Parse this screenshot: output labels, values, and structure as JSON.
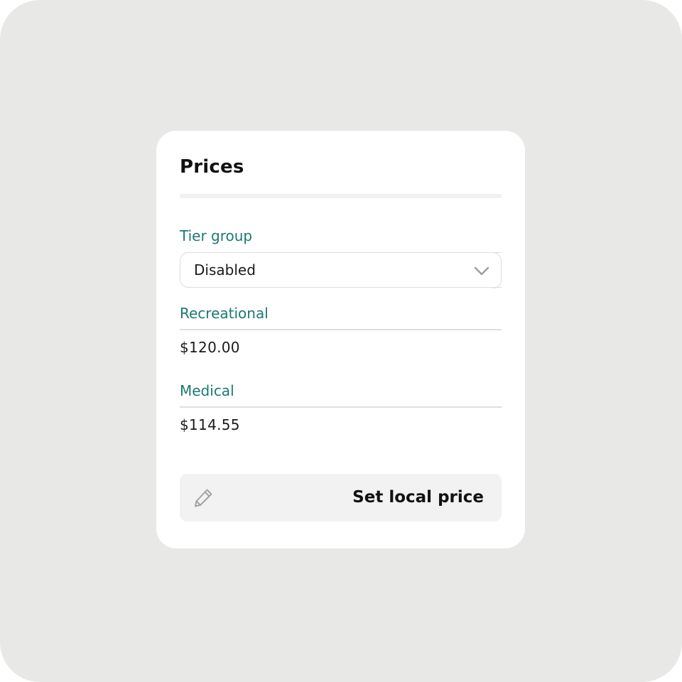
{
  "card": {
    "title": "Prices"
  },
  "tier_group": {
    "label": "Tier group",
    "selected": "Disabled"
  },
  "prices": [
    {
      "label": "Recreational",
      "value": "$120.00"
    },
    {
      "label": "Medical",
      "value": "$114.55"
    }
  ],
  "action": {
    "label": "Set local price",
    "icon": "pencil-icon"
  },
  "colors": {
    "accent": "#1c7a70",
    "background": "#e8e8e6",
    "card": "#ffffff"
  }
}
